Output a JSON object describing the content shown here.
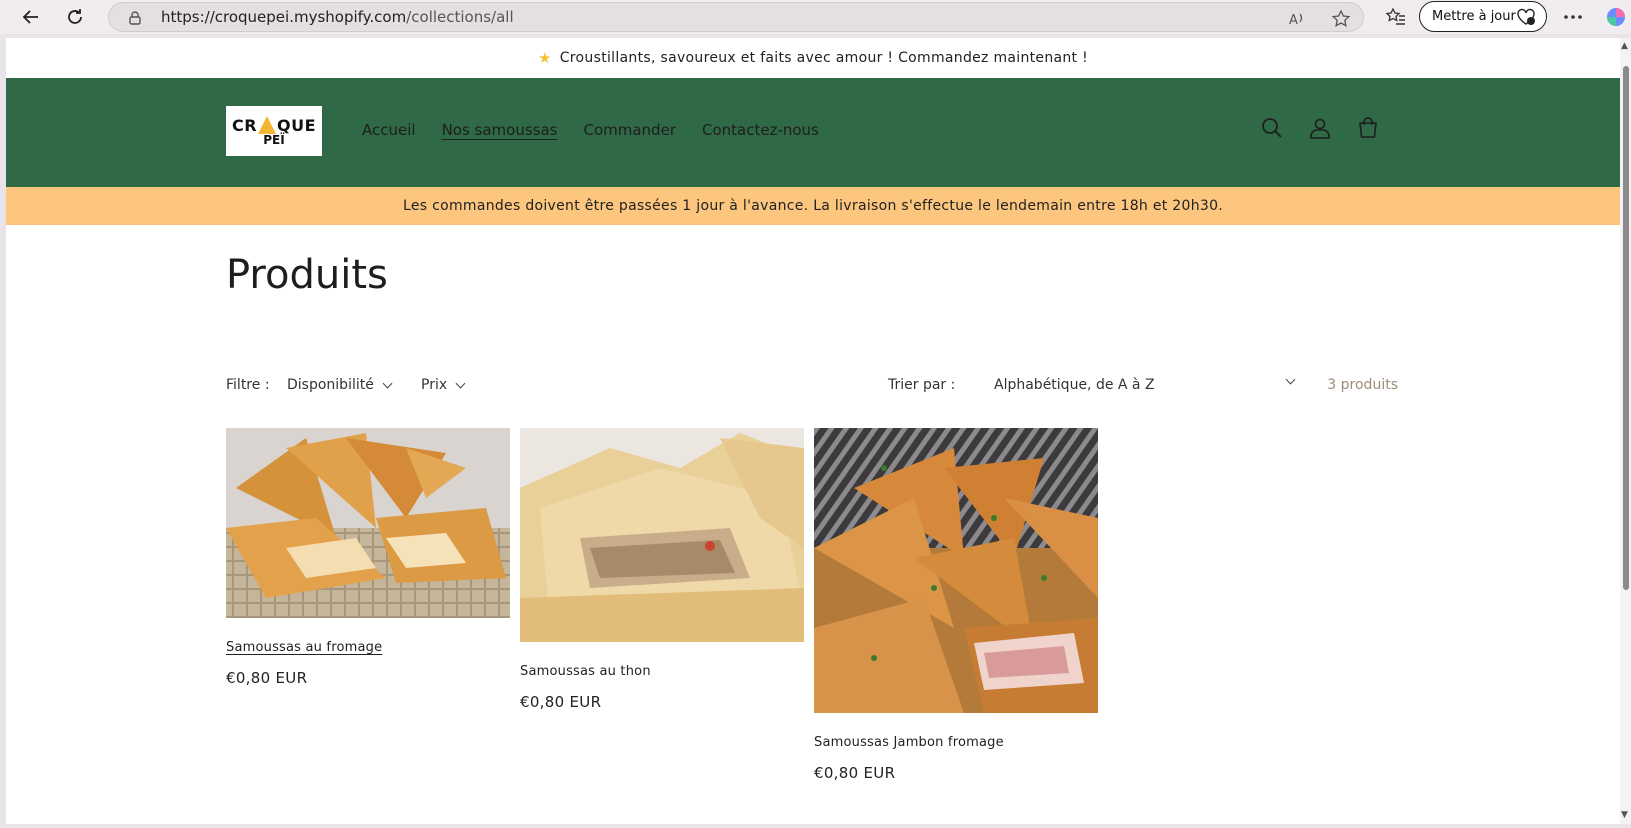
{
  "browser": {
    "url_host": "https://croquepei.myshopify.com",
    "url_path": "/collections/all",
    "update_label": "Mettre à jour"
  },
  "announcement": {
    "text": "Croustillants, savoureux et faits avec amour ! Commandez maintenant !"
  },
  "header": {
    "logo_line1_left": "CR",
    "logo_line1_right": "QUE",
    "logo_line2": "PEÏ",
    "menu": [
      {
        "label": "Accueil"
      },
      {
        "label": "Nos samoussas"
      },
      {
        "label": "Commander"
      },
      {
        "label": "Contactez-nous"
      }
    ],
    "colors": {
      "header_bg": "#2f6946",
      "notice_bg": "#fcc67f"
    }
  },
  "notice": {
    "text": "Les commandes doivent être passées 1 jour à l'avance. La livraison s'effectue le lendemain entre 18h et 20h30."
  },
  "page": {
    "title": "Produits"
  },
  "filters": {
    "filter_label": "Filtre :",
    "availability": "Disponibilité",
    "price": "Prix",
    "sort_label": "Trier par :",
    "sort_value": "Alphabétique, de A à Z",
    "count": "3 produits"
  },
  "products": [
    {
      "title": "Samoussas au fromage",
      "price": "€0,80 EUR"
    },
    {
      "title": "Samoussas au thon",
      "price": "€0,80 EUR"
    },
    {
      "title": "Samoussas Jambon fromage",
      "price": "€0,80 EUR"
    }
  ]
}
